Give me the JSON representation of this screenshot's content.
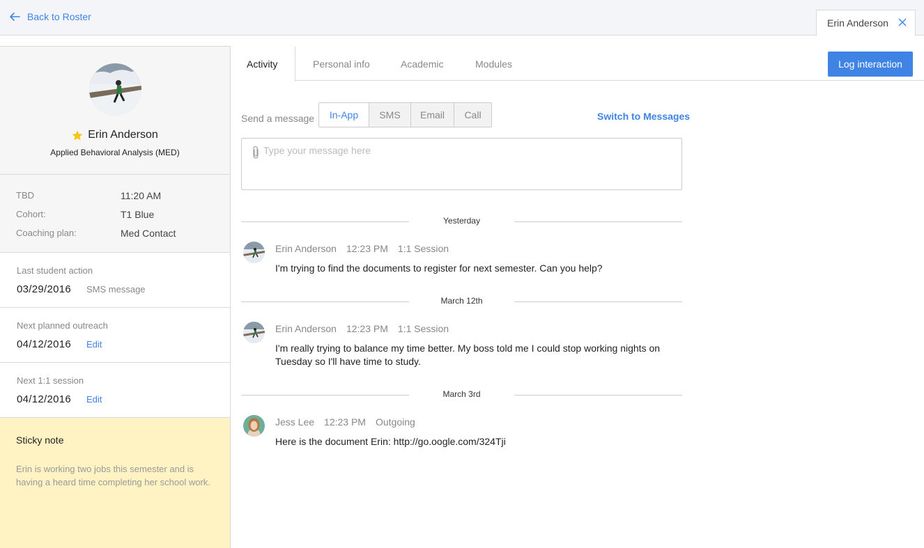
{
  "topbar": {
    "back_label": "Back to Roster",
    "open_tab_label": "Erin Anderson"
  },
  "profile": {
    "name": "Erin Anderson",
    "program": "Applied Behavioral Analysis (MED)",
    "starred": true
  },
  "details": [
    {
      "key": "TBD",
      "value": "11:20 AM"
    },
    {
      "key": "Cohort:",
      "value": "T1 Blue"
    },
    {
      "key": "Coaching plan:",
      "value": "Med Contact"
    }
  ],
  "cards": {
    "last_action": {
      "label": "Last student action",
      "date": "03/29/2016",
      "aux": "SMS message"
    },
    "next_outreach": {
      "label": "Next planned outreach",
      "date": "04/12/2016",
      "edit": "Edit"
    },
    "next_session": {
      "label": "Next 1:1 session",
      "date": "04/12/2016",
      "edit": "Edit"
    }
  },
  "sticky": {
    "title": "Sticky note",
    "body": "Erin is working two jobs this semester and is having a heard time completing her school work."
  },
  "tabs": [
    "Activity",
    "Personal info",
    "Academic",
    "Modules"
  ],
  "active_tab": "Activity",
  "log_button": "Log interaction",
  "composer": {
    "send_label": "Send a message",
    "channels": [
      "In-App",
      "SMS",
      "Email",
      "Call"
    ],
    "active_channel": "In-App",
    "switch_label": "Switch to Messages",
    "placeholder": "Type your message here"
  },
  "separators": [
    "Yesterday",
    "March 12th",
    "March 3rd"
  ],
  "entries": [
    {
      "author": "Erin Anderson",
      "time": "12:23 PM",
      "kind": "1:1 Session",
      "text": "I'm trying to find the documents to register for next semester. Can you help?"
    },
    {
      "author": "Erin Anderson",
      "time": "12:23 PM",
      "kind": "1:1 Session",
      "text": "I'm really trying to balance my time better. My boss told me I could stop working nights on Tuesday so I'll have time to study."
    },
    {
      "author": "Jess Lee",
      "time": "12:23 PM",
      "kind": "Outgoing",
      "text": "Here is the document Erin: http://go.oogle.com/324Tji"
    }
  ],
  "colors": {
    "accent": "#3f84e5",
    "sticky_bg": "#fff3c4",
    "star": "#f5c518"
  }
}
